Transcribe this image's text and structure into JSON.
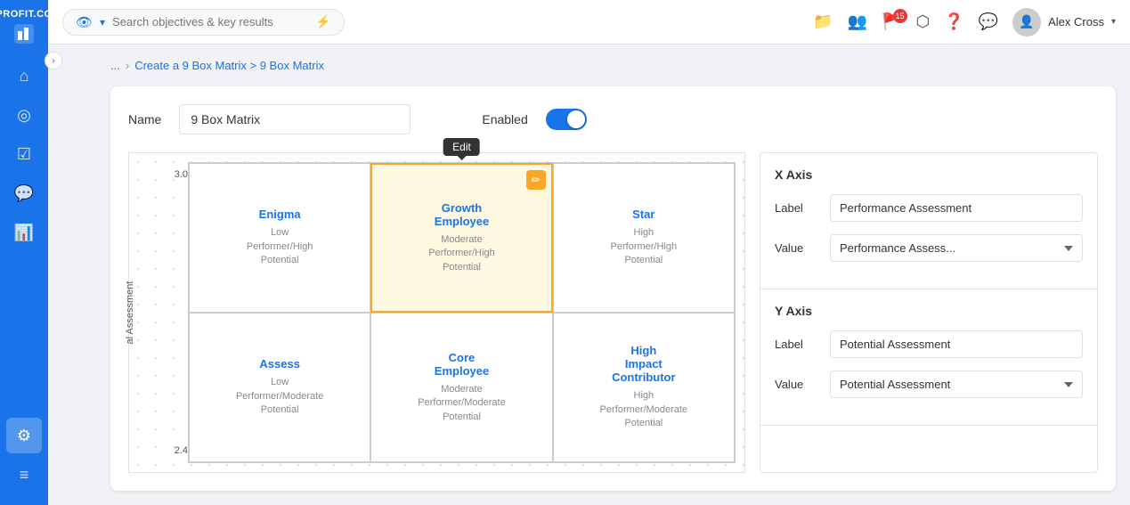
{
  "app": {
    "title": "Profit.co",
    "logo_text": "PROFIT.CO"
  },
  "topbar": {
    "search_placeholder": "Search objectives & key results",
    "notification_count": "15",
    "user_name": "Alex Cross"
  },
  "breadcrumb": {
    "items": [
      "...",
      "Create a 9 Box Matrix > 9 Box Matrix"
    ]
  },
  "form": {
    "name_label": "Name",
    "name_value": "9 Box Matrix",
    "enabled_label": "Enabled",
    "enabled": true
  },
  "edit_tooltip": "Edit",
  "matrix": {
    "y_axis_label": "al Assessment",
    "y_labels": [
      "3.0",
      "2.4"
    ],
    "cells": [
      {
        "title": "Enigma",
        "line1": "Low",
        "line2": "Performer/High",
        "line3": "Potential",
        "highlighted": false
      },
      {
        "title": "Growth Employee",
        "line1": "Moderate",
        "line2": "Performer/High",
        "line3": "Potential",
        "highlighted": true
      },
      {
        "title": "Star",
        "line1": "High",
        "line2": "Performer/High",
        "line3": "Potential",
        "highlighted": false
      },
      {
        "title": "Assess",
        "line1": "Low",
        "line2": "Performer/Moderate",
        "line3": "Potential",
        "highlighted": false
      },
      {
        "title": "Core Employee",
        "line1": "Moderate",
        "line2": "Performer/Moderate",
        "line3": "Potential",
        "highlighted": false
      },
      {
        "title": "High Impact Contributor",
        "line1": "High",
        "line2": "Performer/Moderate",
        "line3": "Potential",
        "highlighted": false
      }
    ]
  },
  "x_axis": {
    "title": "X Axis",
    "label_label": "Label",
    "label_value": "Performance Assessment",
    "value_label": "Value",
    "value_value": "Performance Assess..."
  },
  "y_axis": {
    "title": "Y Axis",
    "label_label": "Label",
    "label_value": "Potential Assessment",
    "value_label": "Value",
    "value_value": "Potential Assessment"
  },
  "sidebar": {
    "items": [
      {
        "icon": "⌂",
        "label": "Home"
      },
      {
        "icon": "◎",
        "label": "Objectives"
      },
      {
        "icon": "☑",
        "label": "Tasks"
      },
      {
        "icon": "💬",
        "label": "Feedback"
      },
      {
        "icon": "📊",
        "label": "Analytics"
      },
      {
        "icon": "⚙",
        "label": "Settings"
      },
      {
        "icon": "≡",
        "label": "More"
      }
    ]
  }
}
